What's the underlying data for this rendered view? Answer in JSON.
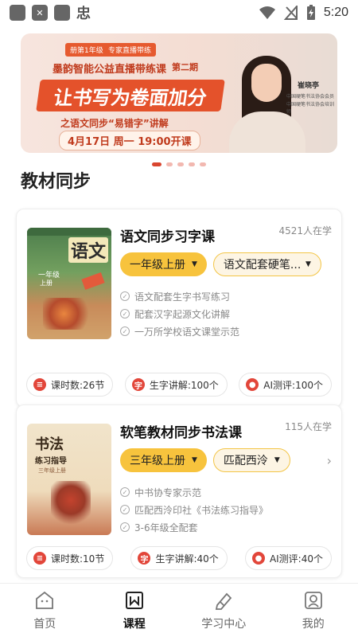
{
  "status_bar": {
    "time": "5:20",
    "left_icons": [
      "app-icon",
      "shield-icon",
      "app-icon",
      "chinese-app-icon"
    ],
    "right_icons": [
      "wifi-icon",
      "no-signal-icon",
      "battery-charging-icon"
    ]
  },
  "banner": {
    "tag_grade": "册第1年级",
    "tag_expert": "专家直播带练",
    "headline": "墨韵智能公益直播带练课",
    "period": "第二期",
    "slogan": "让书写为卷面加分",
    "subtitle": "之语文同步“易错字”讲解",
    "schedule": "4月17日 周一 19:00开课",
    "teacher_name": "崔晓亭",
    "teacher_title_1": "中国硬笔书法协会会员",
    "teacher_title_2": "中国硬笔书法协会培训师",
    "active_dot": 0,
    "dot_count": 5
  },
  "section": {
    "title": "教材同步"
  },
  "courses": [
    {
      "title": "语文同步习字课",
      "learners": "4521人在学",
      "cover_title": "语文",
      "cover_grade": "一年级",
      "cover_vol": "上册",
      "grade_select": "一年级上册",
      "edition_select": "语文配套硬笔...",
      "features": [
        "语文配套生字书写练习",
        "配套汉字起源文化讲解",
        "一万所学校语文课堂示范"
      ],
      "badges": [
        {
          "icon": "lesson-icon",
          "label": "课时数:26节"
        },
        {
          "icon": "character-icon",
          "label": "生字讲解:100个"
        },
        {
          "icon": "ai-icon",
          "label": "AI测评:100个"
        }
      ]
    },
    {
      "title": "软笔教材同步书法课",
      "learners": "115人在学",
      "cover_title": "书法",
      "cover_sub": "练习指导",
      "cover_vol": "三年级上册",
      "grade_select": "三年级上册",
      "edition_select": "匹配西泠",
      "features": [
        "中书协专家示范",
        "匹配西泠印社《书法练习指导》",
        "3-6年级全配套"
      ],
      "badges": [
        {
          "icon": "lesson-icon",
          "label": "课时数:10节"
        },
        {
          "icon": "character-icon",
          "label": "生字讲解:40个"
        },
        {
          "icon": "ai-icon",
          "label": "AI测评:40个"
        }
      ]
    }
  ],
  "tabbar": [
    {
      "label": "首页",
      "icon": "home-icon",
      "active": false
    },
    {
      "label": "课程",
      "icon": "course-icon",
      "active": true
    },
    {
      "label": "学习中心",
      "icon": "study-center-icon",
      "active": false
    },
    {
      "label": "我的",
      "icon": "profile-icon",
      "active": false
    }
  ],
  "colors": {
    "accent_yellow": "#f7c33d",
    "accent_red": "#e2463a",
    "banner_red": "#e4522b"
  }
}
